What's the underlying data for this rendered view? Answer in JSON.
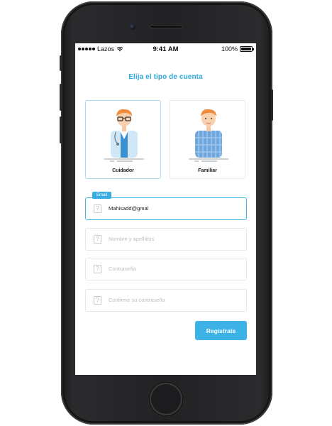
{
  "status_bar": {
    "carrier": "Lazos",
    "time": "9:41 AM",
    "battery": "100%"
  },
  "header": {
    "title": "Elija el tipo de cuenta"
  },
  "account_types": [
    {
      "label": "Cuidador",
      "selected": true
    },
    {
      "label": "Familiar",
      "selected": false
    }
  ],
  "form": {
    "email": {
      "floating_label": "Email",
      "value": "Mahisadd@gmal"
    },
    "name": {
      "placeholder": "Nombre y apellidos"
    },
    "password": {
      "placeholder": "Contraseña"
    },
    "confirm_password": {
      "placeholder": "Confirme su contraseña"
    },
    "field_icon_glyph": "?",
    "submit_label": "Registrate"
  },
  "colors": {
    "accent": "#2ea7e0",
    "button": "#3cb2e6",
    "selected_border": "#a9dcf3"
  },
  "icons": [
    "wifi-icon",
    "battery-icon",
    "question-mark-icon",
    "signal-dots-icon"
  ]
}
